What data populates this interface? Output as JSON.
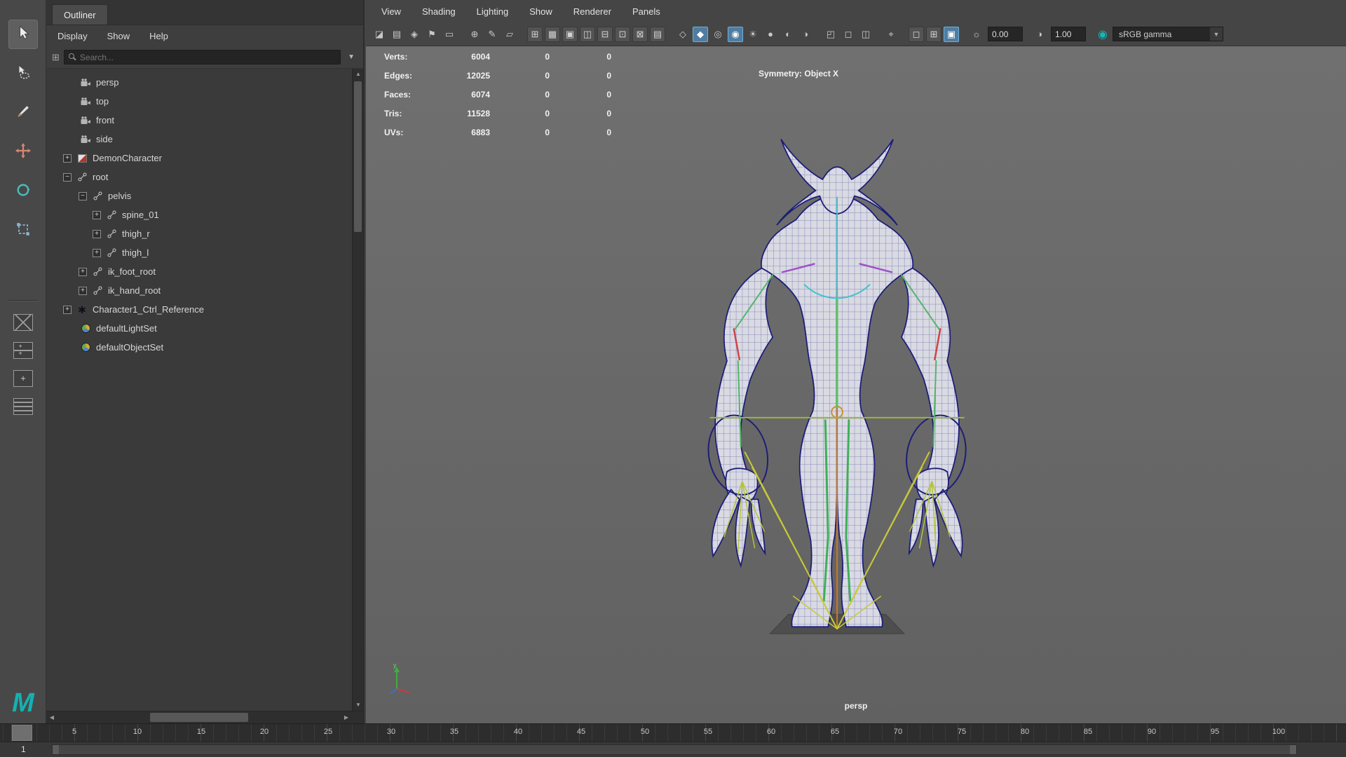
{
  "window": {
    "bg": "#454545",
    "accent_blue": "#4f7ca0",
    "teal": "#16b6b6"
  },
  "left_toolbar": {
    "tools": [
      "select",
      "lasso",
      "paint-select",
      "move",
      "rotate",
      "scale"
    ],
    "layouts": [
      "four-view",
      "pane-stack",
      "pane-plus",
      "outliner-list"
    ],
    "logo": "M"
  },
  "outliner": {
    "tab": "Outliner",
    "menu": [
      "Display",
      "Show",
      "Help"
    ],
    "search_placeholder": "Search...",
    "items": [
      {
        "label": "persp"
      },
      {
        "label": "top"
      },
      {
        "label": "front"
      },
      {
        "label": "side"
      },
      {
        "label": "DemonCharacter",
        "exp": "+"
      },
      {
        "label": "root",
        "exp": "−"
      },
      {
        "label": "pelvis",
        "exp": "−"
      },
      {
        "label": "spine_01",
        "exp": "+"
      },
      {
        "label": "thigh_r",
        "exp": "+"
      },
      {
        "label": "thigh_l",
        "exp": "+"
      },
      {
        "label": "ik_foot_root",
        "exp": "+"
      },
      {
        "label": "ik_hand_root",
        "exp": "+"
      },
      {
        "label": "Character1_Ctrl_Reference",
        "exp": "+"
      },
      {
        "label": "defaultLightSet"
      },
      {
        "label": "defaultObjectSet"
      }
    ]
  },
  "viewport": {
    "menus": [
      "View",
      "Shading",
      "Lighting",
      "Show",
      "Renderer",
      "Panels"
    ],
    "toolbar": [
      {
        "name": "clapperboard",
        "glyph": "◪"
      },
      {
        "name": "camera-attributes",
        "glyph": "▤"
      },
      {
        "name": "camera-lock",
        "glyph": "◈"
      },
      {
        "name": "bookmark",
        "glyph": "⚑"
      },
      {
        "name": "image-plane",
        "glyph": "▭"
      },
      {
        "name": "pan-zoom",
        "glyph": "⊕"
      },
      {
        "name": "grease-pencil",
        "glyph": "✎"
      },
      {
        "name": "measure",
        "glyph": "▱"
      },
      {
        "name": "grid",
        "glyph": "⊞"
      },
      {
        "name": "film-gate",
        "glyph": "▦"
      },
      {
        "name": "resolution-gate",
        "glyph": "▣"
      },
      {
        "name": "gate-mask",
        "glyph": "◫"
      },
      {
        "name": "field-chart",
        "glyph": "⊟"
      },
      {
        "name": "safe-action",
        "glyph": "⊡"
      },
      {
        "name": "safe-title",
        "glyph": "⊠"
      },
      {
        "name": "hud-toggle",
        "glyph": "▤"
      },
      {
        "name": "wireframe",
        "glyph": "◇"
      },
      {
        "name": "smooth-shade",
        "glyph": "◆"
      },
      {
        "name": "use-default-material",
        "glyph": "◎"
      },
      {
        "name": "textured",
        "glyph": "◉"
      },
      {
        "name": "lights",
        "glyph": "☀"
      },
      {
        "name": "shadows",
        "glyph": "●"
      },
      {
        "name": "occlusion",
        "glyph": "◐"
      },
      {
        "name": "motion-blur",
        "glyph": "◑"
      },
      {
        "name": "isolate-select",
        "glyph": "◰"
      },
      {
        "name": "xray",
        "glyph": "◻"
      },
      {
        "name": "xray-joints",
        "glyph": "◫"
      },
      {
        "name": "snap-select",
        "glyph": "⌖"
      },
      {
        "name": "pane-single",
        "glyph": "◻"
      },
      {
        "name": "pane-four",
        "glyph": "⊞"
      },
      {
        "name": "pane-active",
        "glyph": "▣"
      },
      {
        "name": "exposure",
        "glyph": "☼"
      },
      {
        "name": "gamma",
        "glyph": "◑"
      },
      {
        "name": "view-transform",
        "glyph": "◉"
      }
    ],
    "exposure": "0.00",
    "gamma": "1.00",
    "color_space": "sRGB gamma",
    "hud": {
      "rows": [
        {
          "label": "Verts:",
          "v1": "6004",
          "v2": "0",
          "v3": "0"
        },
        {
          "label": "Edges:",
          "v1": "12025",
          "v2": "0",
          "v3": "0"
        },
        {
          "label": "Faces:",
          "v1": "6074",
          "v2": "0",
          "v3": "0"
        },
        {
          "label": "Tris:",
          "v1": "11528",
          "v2": "0",
          "v3": "0"
        },
        {
          "label": "UVs:",
          "v1": "6883",
          "v2": "0",
          "v3": "0"
        }
      ],
      "symmetry": "Symmetry: Object X"
    },
    "camera_label": "persp"
  },
  "timeline": {
    "ticks": [
      5,
      10,
      15,
      20,
      25,
      30,
      35,
      40,
      45,
      50,
      55,
      60,
      65,
      70,
      75,
      80,
      85,
      90,
      95,
      100
    ],
    "range_start": "1"
  }
}
